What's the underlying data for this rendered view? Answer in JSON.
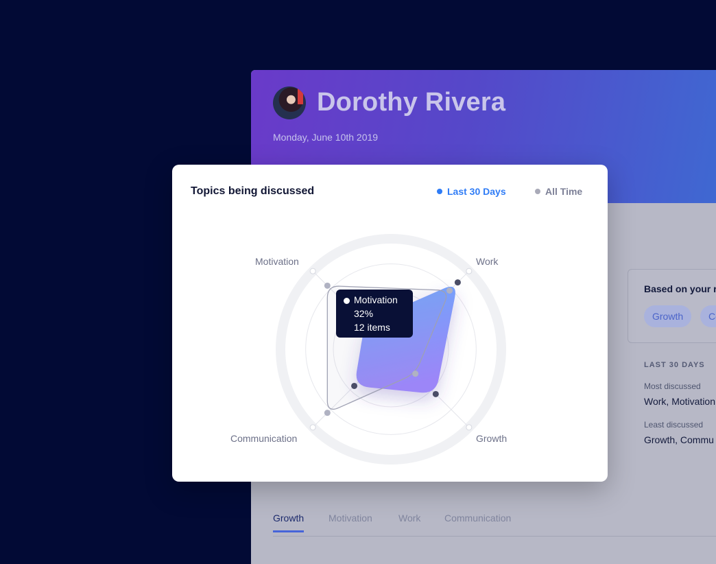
{
  "profile": {
    "name": "Dorothy Rivera",
    "date": "Monday, June 10th 2019"
  },
  "recommendations": {
    "title": "Based on your r",
    "chips": [
      "Growth",
      "Co"
    ]
  },
  "stats": {
    "heading": "LAST 30 DAYS",
    "most_label": "Most discussed",
    "most_value": "Work, Motivation",
    "least_label": "Least discussed",
    "least_value": "Growth, Commu"
  },
  "tabs": [
    "Growth",
    "Motivation",
    "Work",
    "Communication"
  ],
  "card": {
    "title": "Topics being discussed",
    "legend": [
      {
        "label": "Last 30 Days",
        "color": "#2f7cf6"
      },
      {
        "label": "All Time",
        "color": "#a9aab8"
      }
    ],
    "tooltip": {
      "topic": "Motivation",
      "percent": "32%",
      "items": "12 items"
    }
  },
  "chart_data": {
    "type": "radar",
    "title": "Topics being discussed",
    "axes": [
      "Motivation",
      "Work",
      "Growth",
      "Communication"
    ],
    "rmax": 1,
    "series": [
      {
        "name": "Last 30 Days",
        "values": [
          0.32,
          0.82,
          0.55,
          0.45
        ],
        "color": "#7f8ff7"
      },
      {
        "name": "All Time",
        "values": [
          0.78,
          0.72,
          0.3,
          0.78
        ],
        "color": "#a9aab8"
      }
    ]
  }
}
